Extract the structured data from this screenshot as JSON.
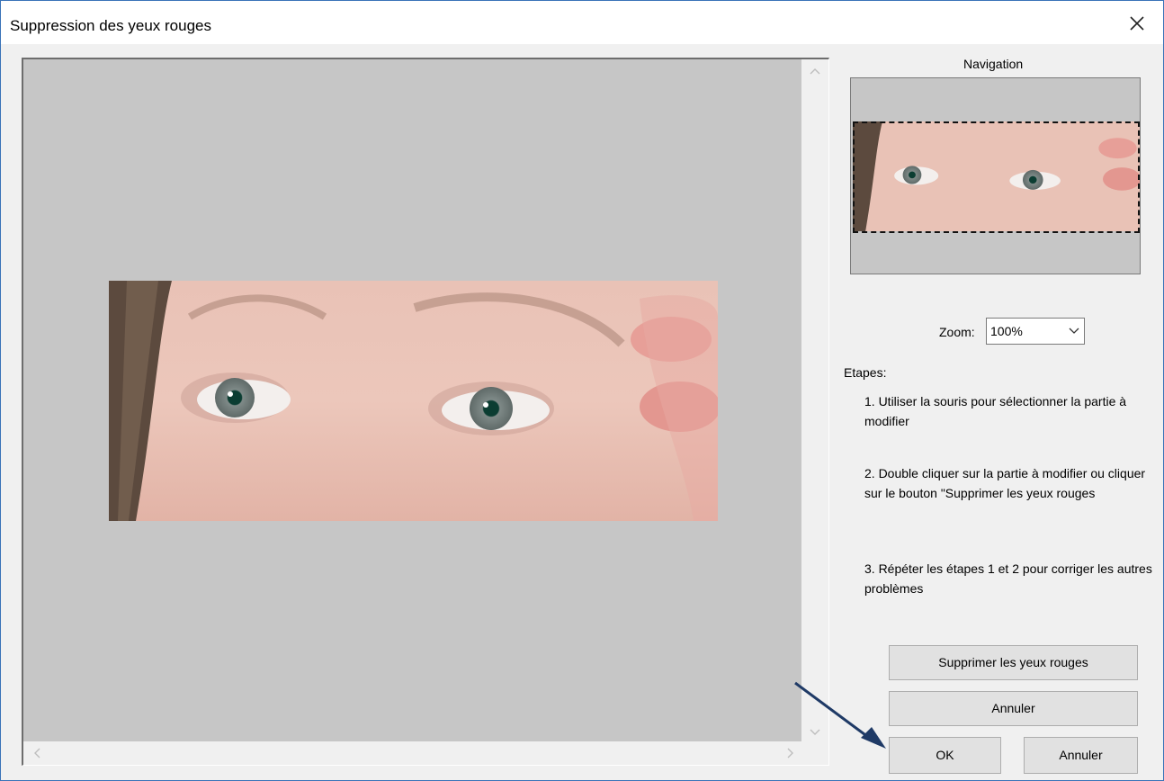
{
  "window": {
    "title": "Suppression des yeux rouges"
  },
  "navigation": {
    "label": "Navigation"
  },
  "zoom": {
    "label": "Zoom:",
    "selected": "100%"
  },
  "steps": {
    "label": "Etapes:",
    "items": [
      "1. Utiliser la souris pour sélectionner la partie à modifier",
      "2. Double cliquer sur la partie à modifier ou cliquer sur le bouton \"Supprimer les yeux rouges",
      "3. Répéter les étapes 1 et 2 pour corriger les autres problèmes"
    ]
  },
  "buttons": {
    "remove_red_eye": "Supprimer les yeux rouges",
    "cancel_step": "Annuler",
    "ok": "OK",
    "cancel": "Annuler"
  },
  "icons": {
    "close": "close-icon",
    "scroll_up": "chevron-up-icon",
    "scroll_down": "chevron-down-icon",
    "scroll_left": "chevron-left-icon",
    "scroll_right": "chevron-right-icon",
    "zoom_dropdown": "chevron-down-icon",
    "pointer": "arrow-pointer-icon"
  },
  "colors": {
    "window_border": "#3a73b8",
    "canvas_background": "#c6c6c6",
    "dialog_background": "#f0f0f0",
    "button_background": "#e1e1e1",
    "pointer_arrow": "#1f3a66"
  }
}
